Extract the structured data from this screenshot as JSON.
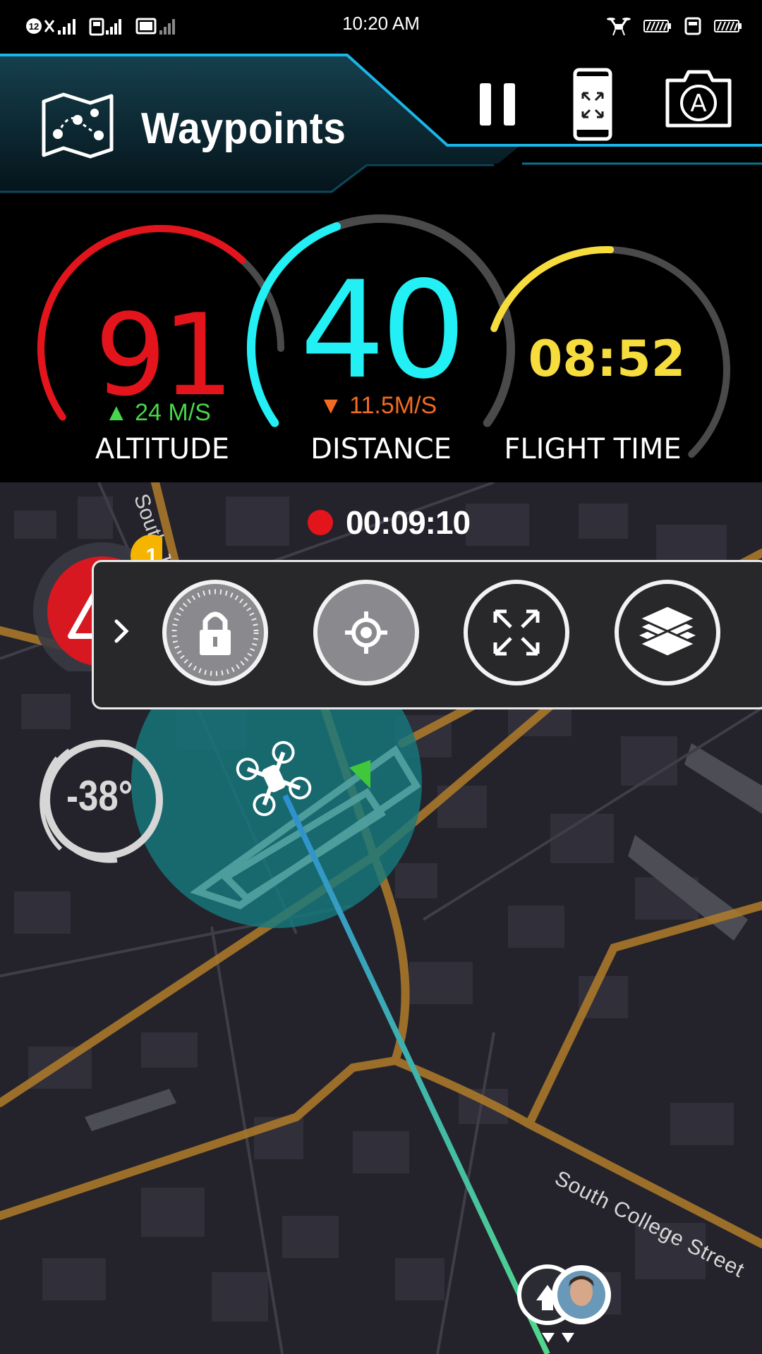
{
  "status_bar": {
    "time": "10:20 AM",
    "sim_badge": "12",
    "icons": [
      "sim-signal-icon",
      "mobile-data-signal-icon",
      "cast-signal-icon",
      "drone-icon",
      "drone-battery-icon",
      "remote-controller-icon",
      "phone-battery-icon"
    ]
  },
  "header": {
    "title": "Waypoints",
    "icons": [
      "waypoints-map-icon",
      "pause-icon",
      "fullscreen-phone-icon",
      "auto-camera-icon"
    ],
    "camera_mode_letter": "A",
    "accent_color": "#1ab6e8"
  },
  "telemetry": {
    "altitude": {
      "value": "91",
      "rate": "24 M/S",
      "rate_direction": "up",
      "label": "ALTITUDE",
      "color": "#e3141c",
      "fill": 0.78
    },
    "distance": {
      "value": "40",
      "rate": "11.5M/S",
      "rate_direction": "down",
      "label": "DISTANCE",
      "color": "#22f0f5",
      "fill": 0.42
    },
    "flight_time": {
      "value": "08:52",
      "label": "FLIGHT TIME",
      "color": "#f6dc3d",
      "fill": 0.35
    }
  },
  "recording": {
    "time": "00:09:10",
    "color": "#e3141c"
  },
  "warning": {
    "badge_count": "1",
    "color": "#e3141c"
  },
  "toolbar": {
    "buttons": [
      "lock-icon",
      "target-icon",
      "expand-icon",
      "layers-icon"
    ]
  },
  "compass": {
    "heading": "-38°"
  },
  "map": {
    "streets": [
      "South College Street",
      "South Jacks"
    ]
  }
}
